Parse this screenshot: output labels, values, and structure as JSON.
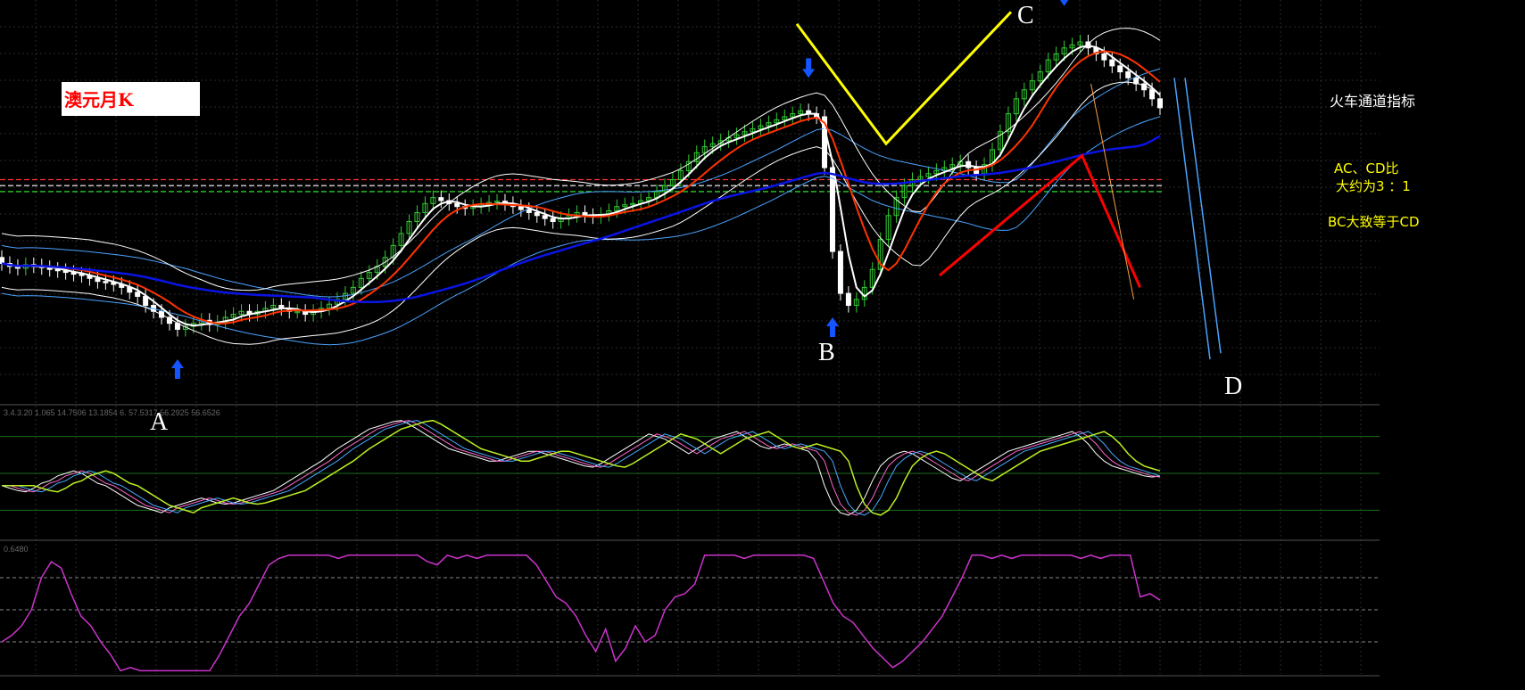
{
  "chart_data": {
    "type": "candlestick",
    "title": "澳元月K",
    "indicator_label": "火车通道指标",
    "notes": [
      "AC、CD比",
      "大约为3 ：1",
      "BC大致等于CD"
    ],
    "pattern_points": [
      "A",
      "B",
      "C",
      "D"
    ],
    "pattern_index": {
      "A": 22,
      "B": 104,
      "C": 133,
      "D": 154
    },
    "price_levels": [
      0.82,
      0.81,
      0.8
    ],
    "grid": true,
    "price_panel": {
      "ylim": [
        0.45,
        1.12
      ],
      "bars": 146,
      "close": [
        0.68,
        0.675,
        0.672,
        0.678,
        0.676,
        0.673,
        0.67,
        0.668,
        0.665,
        0.662,
        0.66,
        0.655,
        0.65,
        0.648,
        0.645,
        0.64,
        0.632,
        0.625,
        0.61,
        0.6,
        0.59,
        0.58,
        0.57,
        0.575,
        0.58,
        0.585,
        0.578,
        0.582,
        0.59,
        0.595,
        0.6,
        0.595,
        0.6,
        0.605,
        0.61,
        0.605,
        0.6,
        0.6,
        0.595,
        0.6,
        0.605,
        0.612,
        0.62,
        0.63,
        0.64,
        0.655,
        0.665,
        0.675,
        0.69,
        0.71,
        0.73,
        0.75,
        0.765,
        0.78,
        0.79,
        0.785,
        0.78,
        0.775,
        0.772,
        0.775,
        0.778,
        0.782,
        0.784,
        0.78,
        0.775,
        0.77,
        0.765,
        0.76,
        0.755,
        0.75,
        0.755,
        0.76,
        0.765,
        0.76,
        0.758,
        0.762,
        0.768,
        0.775,
        0.778,
        0.78,
        0.785,
        0.79,
        0.8,
        0.81,
        0.82,
        0.835,
        0.85,
        0.865,
        0.875,
        0.88,
        0.885,
        0.89,
        0.895,
        0.9,
        0.905,
        0.91,
        0.915,
        0.92,
        0.925,
        0.93,
        0.935,
        0.93,
        0.925,
        0.84,
        0.7,
        0.63,
        0.61,
        0.62,
        0.64,
        0.67,
        0.72,
        0.76,
        0.79,
        0.81,
        0.82,
        0.825,
        0.83,
        0.835,
        0.84,
        0.845,
        0.85,
        0.84,
        0.83,
        0.845,
        0.87,
        0.9,
        0.93,
        0.955,
        0.97,
        0.985,
        1.0,
        1.02,
        1.03,
        1.04,
        1.045,
        1.05,
        1.04,
        1.03,
        1.02,
        1.01,
        1.0,
        0.99,
        0.98,
        0.97,
        0.955,
        0.94
      ]
    },
    "oscillator_panel": {
      "header": "3.4.3.20 1.065 14.7506 13.1854 6.  57.5317 56.2925 56.6526",
      "levels": [
        80,
        50,
        20
      ],
      "ylim": [
        0,
        100
      ],
      "line1": [
        40,
        38,
        36,
        35,
        38,
        42,
        44,
        48,
        50,
        52,
        50,
        46,
        42,
        40,
        36,
        32,
        28,
        24,
        22,
        20,
        18,
        22,
        24,
        26,
        28,
        30,
        28,
        26,
        25,
        26,
        28,
        30,
        32,
        34,
        36,
        40,
        44,
        48,
        52,
        56,
        60,
        65,
        70,
        74,
        78,
        82,
        86,
        88,
        90,
        92,
        93,
        90,
        86,
        82,
        78,
        74,
        70,
        68,
        66,
        64,
        62,
        60,
        60,
        62,
        64,
        66,
        68,
        68,
        66,
        64,
        62,
        60,
        58,
        56,
        55,
        58,
        62,
        66,
        70,
        74,
        78,
        82,
        80,
        78,
        74,
        70,
        66,
        70,
        74,
        78,
        80,
        82,
        84,
        80,
        76,
        72,
        70,
        72,
        74,
        72,
        70,
        68,
        60,
        40,
        25,
        18,
        16,
        20,
        30,
        44,
        56,
        62,
        66,
        68,
        66,
        62,
        58,
        54,
        50,
        46,
        44,
        48,
        52,
        56,
        60,
        64,
        68,
        70,
        72,
        74,
        76,
        78,
        80,
        82,
        84,
        80,
        74,
        66,
        60,
        56,
        54,
        52,
        50,
        48,
        47,
        48
      ]
    },
    "histogram_panel": {
      "header": "0.6480",
      "levels": [
        3,
        2,
        1
      ],
      "ylim": [
        0,
        4
      ],
      "values": [
        1,
        1.2,
        1.5,
        2,
        3,
        3.5,
        3.3,
        2.5,
        1.8,
        1.5,
        1.0,
        0.6,
        0.1,
        0.2,
        0.1,
        0.1,
        0.1,
        0.1,
        0.1,
        0.1,
        0.1,
        0.1,
        0.6,
        1.2,
        1.8,
        2.2,
        2.8,
        3.4,
        3.6,
        3.7,
        3.7,
        3.7,
        3.7,
        3.7,
        3.6,
        3.7,
        3.7,
        3.7,
        3.7,
        3.7,
        3.7,
        3.7,
        3.7,
        3.5,
        3.4,
        3.7,
        3.6,
        3.7,
        3.6,
        3.7,
        3.7,
        3.7,
        3.7,
        3.7,
        3.4,
        2.9,
        2.4,
        2.2,
        1.8,
        1.2,
        0.7,
        1.4,
        0.4,
        0.8,
        1.5,
        1.0,
        1.2,
        2.0,
        2.4,
        2.5,
        2.8,
        3.7,
        3.7,
        3.7,
        3.7,
        3.6,
        3.7,
        3.7,
        3.7,
        3.7,
        3.7,
        3.7,
        3.6,
        2.9,
        2.2,
        1.8,
        1.6,
        1.2,
        0.8,
        0.5,
        0.2,
        0.4,
        0.7,
        1.0,
        1.4,
        1.8,
        2.4,
        3.0,
        3.7,
        3.7,
        3.6,
        3.7,
        3.6,
        3.7,
        3.7,
        3.7,
        3.7,
        3.7,
        3.7,
        3.6,
        3.7,
        3.6,
        3.7,
        3.7,
        3.7,
        2.4,
        2.5,
        2.3
      ]
    }
  },
  "colors": {
    "background": "#000000",
    "grid": "#2a2a2a",
    "bull": "#33cc33",
    "bear": "#ffffff",
    "ma_red": "#ff3300",
    "ma_blue": "#0a14e6",
    "ma_white": "#ffffff",
    "ma_light": "#4aa3ff",
    "yellow_marker": "#ffff00",
    "red_marker": "#ff0000",
    "hist_line": "#cc33cc",
    "signal_arrow": "#1455ff"
  }
}
